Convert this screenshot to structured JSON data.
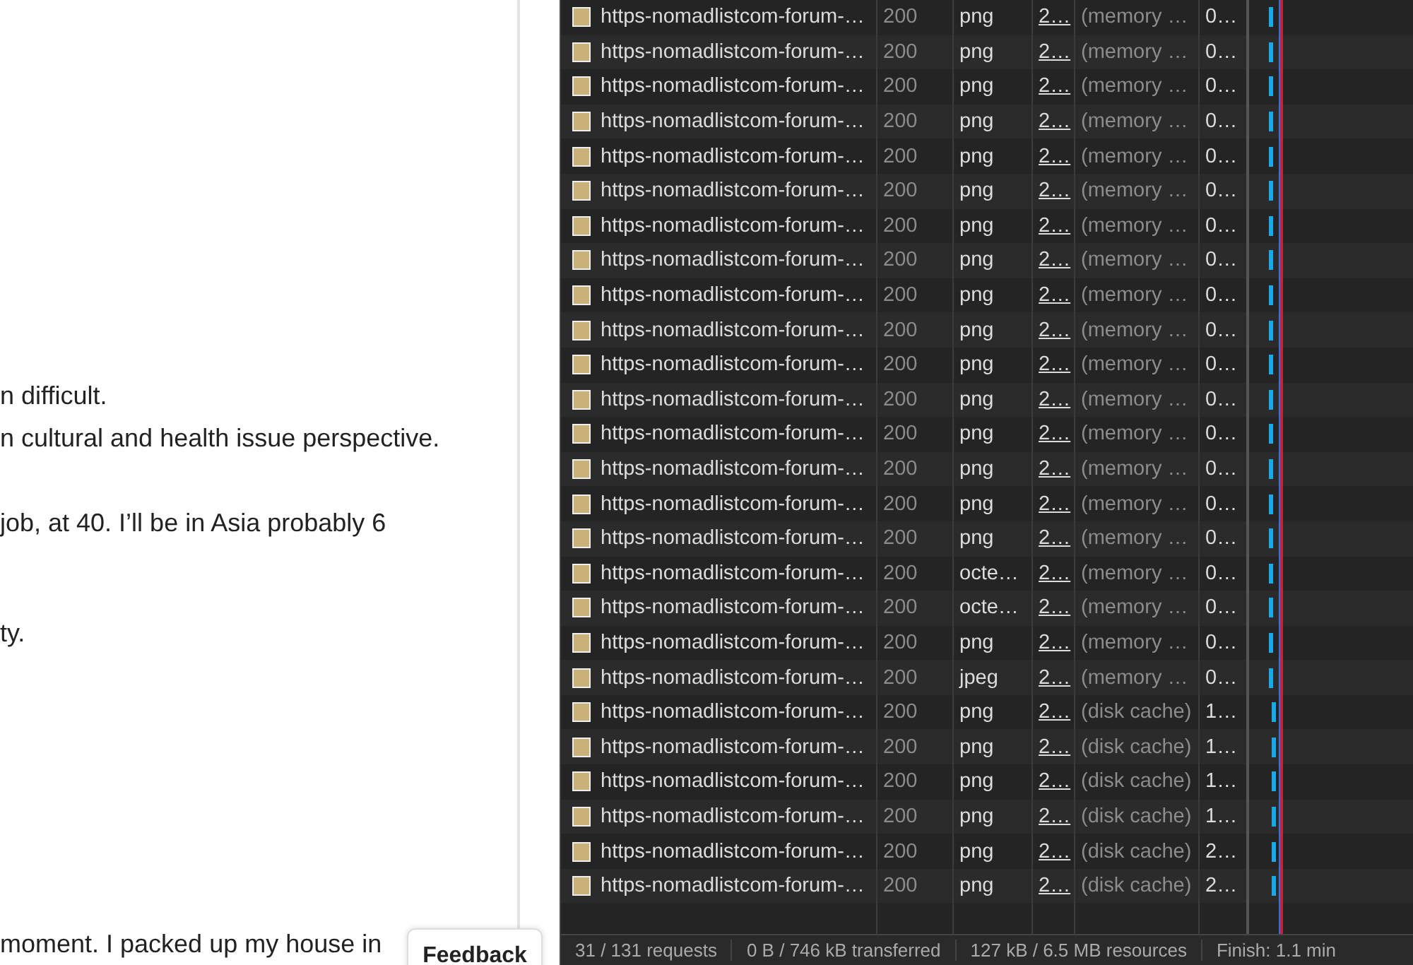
{
  "article": {
    "lines": [
      "n difficult.",
      "n cultural and health issue perspective.",
      "job, at 40. I’ll be in Asia probably 6",
      "ty.",
      "moment. I packed up my house in"
    ]
  },
  "feedback_button": "Feedback",
  "requests": [
    {
      "name": "https-nomadlistcom-forum-…",
      "status": "200",
      "type": "png",
      "size": "2…",
      "source": "(memory …",
      "time": "0…"
    },
    {
      "name": "https-nomadlistcom-forum-…",
      "status": "200",
      "type": "png",
      "size": "2…",
      "source": "(memory …",
      "time": "0…"
    },
    {
      "name": "https-nomadlistcom-forum-…",
      "status": "200",
      "type": "png",
      "size": "2…",
      "source": "(memory …",
      "time": "0…"
    },
    {
      "name": "https-nomadlistcom-forum-…",
      "status": "200",
      "type": "png",
      "size": "2…",
      "source": "(memory …",
      "time": "0…"
    },
    {
      "name": "https-nomadlistcom-forum-…",
      "status": "200",
      "type": "png",
      "size": "2…",
      "source": "(memory …",
      "time": "0…"
    },
    {
      "name": "https-nomadlistcom-forum-…",
      "status": "200",
      "type": "png",
      "size": "2…",
      "source": "(memory …",
      "time": "0…"
    },
    {
      "name": "https-nomadlistcom-forum-…",
      "status": "200",
      "type": "png",
      "size": "2…",
      "source": "(memory …",
      "time": "0…"
    },
    {
      "name": "https-nomadlistcom-forum-…",
      "status": "200",
      "type": "png",
      "size": "2…",
      "source": "(memory …",
      "time": "0…"
    },
    {
      "name": "https-nomadlistcom-forum-…",
      "status": "200",
      "type": "png",
      "size": "2…",
      "source": "(memory …",
      "time": "0…"
    },
    {
      "name": "https-nomadlistcom-forum-…",
      "status": "200",
      "type": "png",
      "size": "2…",
      "source": "(memory …",
      "time": "0…"
    },
    {
      "name": "https-nomadlistcom-forum-…",
      "status": "200",
      "type": "png",
      "size": "2…",
      "source": "(memory …",
      "time": "0…"
    },
    {
      "name": "https-nomadlistcom-forum-…",
      "status": "200",
      "type": "png",
      "size": "2…",
      "source": "(memory …",
      "time": "0…"
    },
    {
      "name": "https-nomadlistcom-forum-…",
      "status": "200",
      "type": "png",
      "size": "2…",
      "source": "(memory …",
      "time": "0…"
    },
    {
      "name": "https-nomadlistcom-forum-…",
      "status": "200",
      "type": "png",
      "size": "2…",
      "source": "(memory …",
      "time": "0…"
    },
    {
      "name": "https-nomadlistcom-forum-…",
      "status": "200",
      "type": "png",
      "size": "2…",
      "source": "(memory …",
      "time": "0…"
    },
    {
      "name": "https-nomadlistcom-forum-…",
      "status": "200",
      "type": "png",
      "size": "2…",
      "source": "(memory …",
      "time": "0…"
    },
    {
      "name": "https-nomadlistcom-forum-…",
      "status": "200",
      "type": "octe…",
      "size": "2…",
      "source": "(memory …",
      "time": "0…"
    },
    {
      "name": "https-nomadlistcom-forum-…",
      "status": "200",
      "type": "octe…",
      "size": "2…",
      "source": "(memory …",
      "time": "0…"
    },
    {
      "name": "https-nomadlistcom-forum-…",
      "status": "200",
      "type": "png",
      "size": "2…",
      "source": "(memory …",
      "time": "0…"
    },
    {
      "name": "https-nomadlistcom-forum-…",
      "status": "200",
      "type": "jpeg",
      "size": "2…",
      "source": "(memory …",
      "time": "0…"
    },
    {
      "name": "https-nomadlistcom-forum-…",
      "status": "200",
      "type": "png",
      "size": "2…",
      "source": "(disk cache)",
      "time": "1…"
    },
    {
      "name": "https-nomadlistcom-forum-…",
      "status": "200",
      "type": "png",
      "size": "2…",
      "source": "(disk cache)",
      "time": "1…"
    },
    {
      "name": "https-nomadlistcom-forum-…",
      "status": "200",
      "type": "png",
      "size": "2…",
      "source": "(disk cache)",
      "time": "1…"
    },
    {
      "name": "https-nomadlistcom-forum-…",
      "status": "200",
      "type": "png",
      "size": "2…",
      "source": "(disk cache)",
      "time": "1…"
    },
    {
      "name": "https-nomadlistcom-forum-…",
      "status": "200",
      "type": "png",
      "size": "2…",
      "source": "(disk cache)",
      "time": "2…"
    },
    {
      "name": "https-nomadlistcom-forum-…",
      "status": "200",
      "type": "png",
      "size": "2…",
      "source": "(disk cache)",
      "time": "2…"
    }
  ],
  "status_bar": [
    "31 / 131 requests",
    "0 B / 746 kB transferred",
    "127 kB / 6.5 MB resources",
    "Finish: 1.1 min"
  ]
}
